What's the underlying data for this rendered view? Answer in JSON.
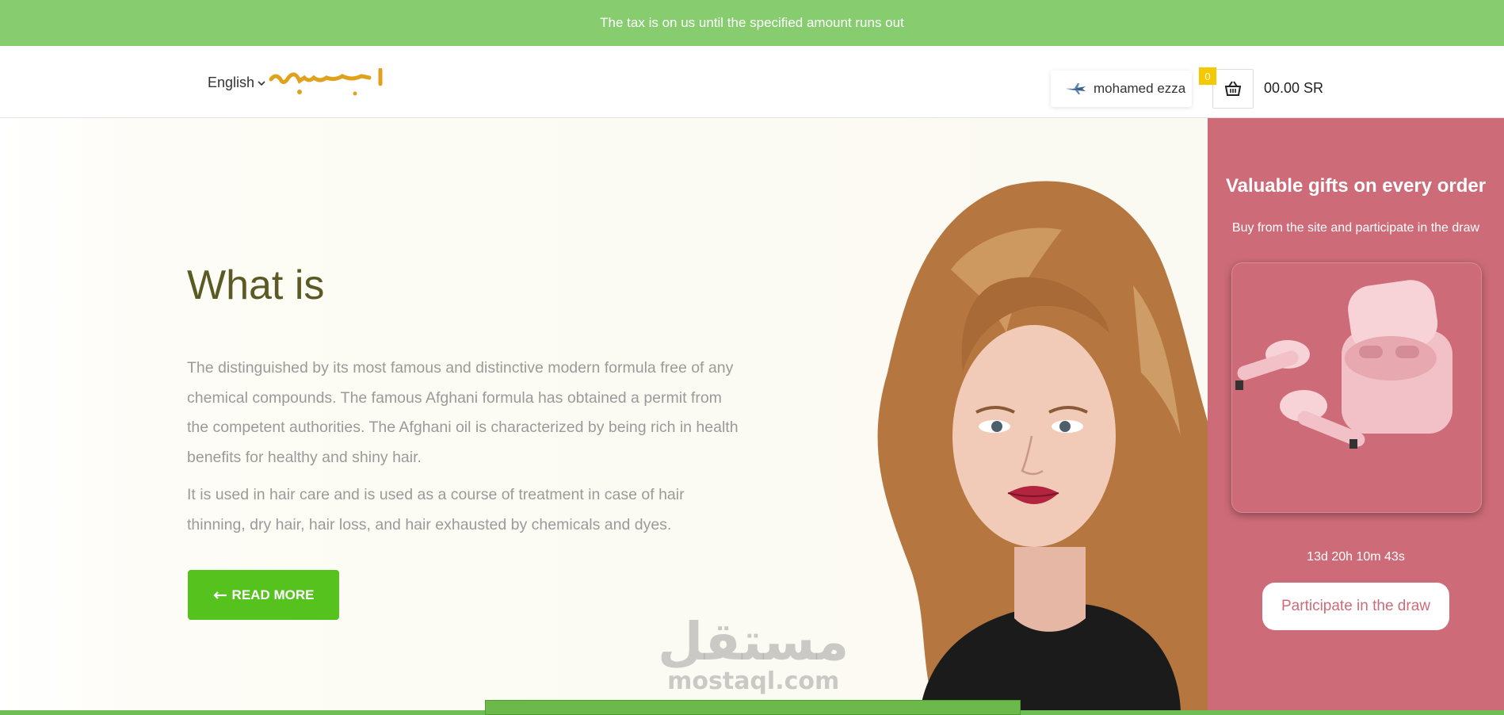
{
  "announcement": "The tax is on us until the specified amount runs out",
  "header": {
    "language": "English",
    "user_name": "mohamed ezza",
    "cart_count": "0",
    "cart_total": "00.00 SR"
  },
  "hero": {
    "title": "What is",
    "paragraph1": "The distinguished by its most famous and distinctive modern formula free of any chemical compounds. The famous Afghani formula has obtained a permit from the competent authorities. The Afghani oil is characterized by being rich in health benefits for healthy and shiny hair.",
    "paragraph2": "It is used in hair care and is used as a course of treatment in case of hair thinning, dry hair, hair loss, and hair exhausted by chemicals and dyes.",
    "button_label": "READ MORE"
  },
  "promo": {
    "title": "Valuable gifts on every order",
    "subtitle": "Buy from the site and participate in the draw",
    "countdown": "13d 20h 10m 43s",
    "button_label": "Participate in the draw"
  },
  "watermark": {
    "arabic": "مستقل",
    "latin": "mostaql.com"
  },
  "colors": {
    "announcement_bg": "#87cd70",
    "button_green": "#55c21d",
    "promo_bg": "#cd6c78",
    "title_olive": "#5b5a25",
    "badge_yellow": "#f5c800"
  },
  "icons": [
    "chevron-down-icon",
    "plane-icon",
    "basket-icon",
    "arrow-left-icon"
  ]
}
